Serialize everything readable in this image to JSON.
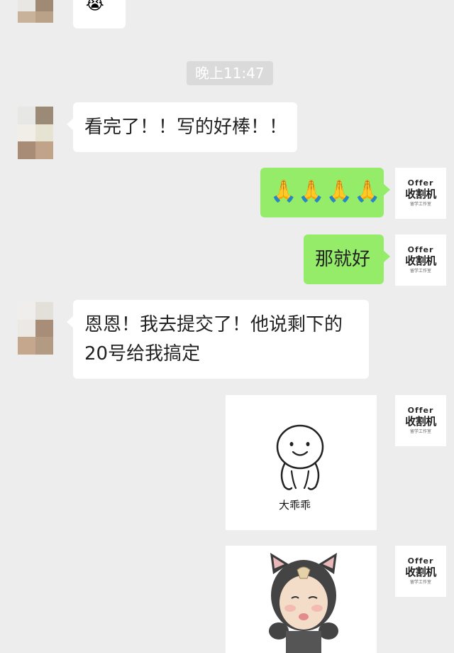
{
  "timestamp": "晚上11:47",
  "messages": {
    "m1": "看完了！！写的好棒！！",
    "m2_emoji": "🙏🙏🙏🙏",
    "m3": "那就好",
    "m4_line1": "恩恩！我去提交了！他说剩下的",
    "m4_line2": "20号给我搞定"
  },
  "sticker1_caption": "大乖乖",
  "offer_avatar": {
    "top": "Offer",
    "mid": "收割机",
    "bot": "留学工作室"
  },
  "colors": {
    "background": "#ededed",
    "green_bubble": "#95ec69",
    "white_bubble": "#ffffff"
  }
}
